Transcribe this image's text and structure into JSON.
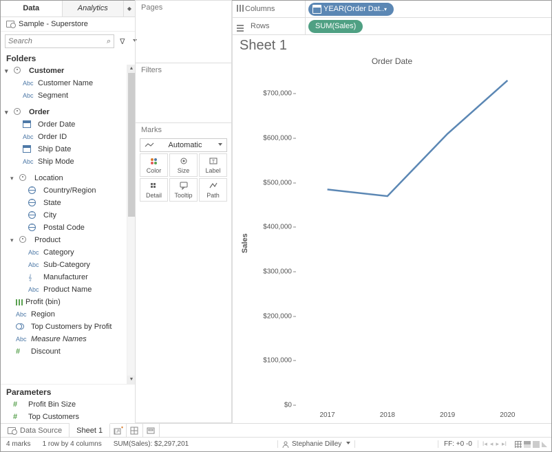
{
  "data_panel": {
    "tabs": {
      "data": "Data",
      "analytics": "Analytics"
    },
    "datasource": "Sample - Superstore",
    "search_placeholder": "Search",
    "folders_header": "Folders",
    "parameters_header": "Parameters",
    "folders": {
      "customer": {
        "label": "Customer",
        "fields": [
          "Customer Name",
          "Segment"
        ]
      },
      "order": {
        "label": "Order",
        "fields": [
          "Order Date",
          "Order ID",
          "Ship Date",
          "Ship Mode"
        ]
      },
      "location": {
        "label": "Location",
        "fields": [
          "Country/Region",
          "State",
          "City",
          "Postal Code"
        ]
      },
      "product": {
        "label": "Product",
        "fields": [
          "Category",
          "Sub-Category",
          "Manufacturer",
          "Product Name"
        ]
      }
    },
    "extra_fields": {
      "profit_bin": "Profit (bin)",
      "region": "Region",
      "top_customers": "Top Customers by Profit",
      "measure_names": "Measure Names",
      "discount": "Discount"
    },
    "parameters": {
      "profit_bin_size": "Profit Bin Size",
      "top_customers": "Top Customers"
    }
  },
  "shelves": {
    "pages": "Pages",
    "filters": "Filters",
    "marks_title": "Marks",
    "marks_type": "Automatic",
    "buttons": {
      "color": "Color",
      "size": "Size",
      "label": "Label",
      "detail": "Detail",
      "tooltip": "Tooltip",
      "path": "Path"
    }
  },
  "viz": {
    "columns_label": "Columns",
    "rows_label": "Rows",
    "columns_pill": "YEAR(Order Dat..",
    "rows_pill": "SUM(Sales)",
    "sheet_title": "Sheet 1",
    "chart_title": "Order Date",
    "y_axis_label": "Sales"
  },
  "chart_data": {
    "type": "line",
    "categories": [
      "2017",
      "2018",
      "2019",
      "2020"
    ],
    "values": [
      485000,
      470000,
      610000,
      730000
    ],
    "title": "Order Date",
    "xlabel": "",
    "ylabel": "Sales",
    "ylim": [
      0,
      750000
    ],
    "yticks": [
      0,
      100000,
      200000,
      300000,
      400000,
      500000,
      600000,
      700000
    ],
    "ytick_labels": [
      "$0",
      "$100,000",
      "$200,000",
      "$300,000",
      "$400,000",
      "$500,000",
      "$600,000",
      "$700,000"
    ]
  },
  "bottom": {
    "data_source_tab": "Data Source",
    "sheet_tab": "Sheet 1"
  },
  "status": {
    "marks": "4 marks",
    "rows_cols": "1 row by 4 columns",
    "sum": "SUM(Sales): $2,297,201",
    "user": "Stephanie Dilley",
    "ff": "FF: +0 -0"
  }
}
